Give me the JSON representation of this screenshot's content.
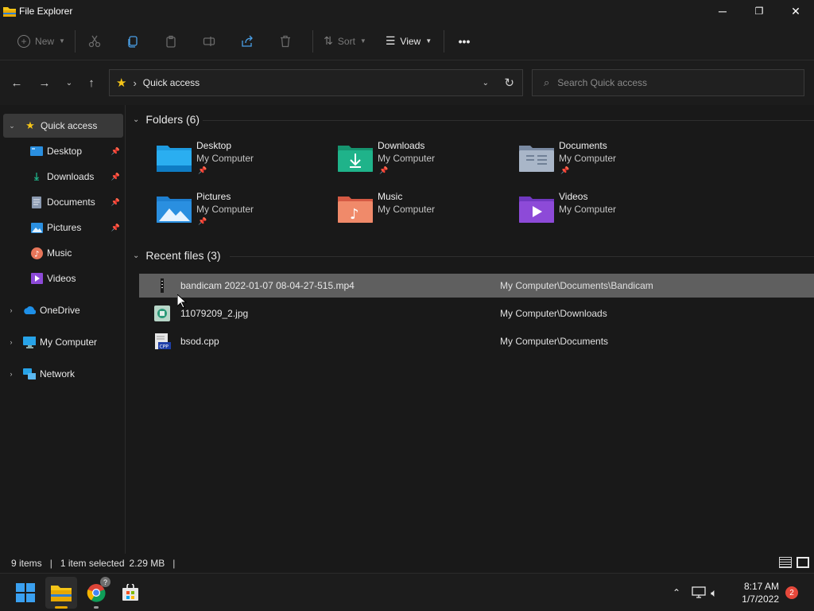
{
  "window": {
    "title": "File Explorer",
    "controls": {
      "minimize": "─",
      "restore": "❐",
      "close": "✕"
    }
  },
  "toolbar": {
    "new_label": "New",
    "sort_label": "Sort",
    "view_label": "View",
    "more_label": "•••"
  },
  "address": {
    "crumb": "Quick access",
    "separator": "›",
    "search_placeholder": "Search Quick access"
  },
  "sidebar": {
    "items": [
      {
        "label": "Quick access",
        "icon": "star-icon",
        "pinned": false
      },
      {
        "label": "Desktop",
        "icon": "desktop-icon",
        "pinned": true
      },
      {
        "label": "Downloads",
        "icon": "download-icon",
        "pinned": true
      },
      {
        "label": "Documents",
        "icon": "document-icon",
        "pinned": true
      },
      {
        "label": "Pictures",
        "icon": "pictures-icon",
        "pinned": true
      },
      {
        "label": "Music",
        "icon": "music-icon",
        "pinned": false
      },
      {
        "label": "Videos",
        "icon": "videos-icon",
        "pinned": false
      },
      {
        "label": "OneDrive",
        "icon": "cloud-icon",
        "pinned": false
      },
      {
        "label": "My Computer",
        "icon": "computer-icon",
        "pinned": false
      },
      {
        "label": "Network",
        "icon": "network-icon",
        "pinned": false
      }
    ]
  },
  "folders": {
    "header": "Folders (6)",
    "items": [
      {
        "name": "Desktop",
        "location": "My Computer",
        "pinned": true,
        "color": "#1e9be0"
      },
      {
        "name": "Downloads",
        "location": "My Computer",
        "pinned": true,
        "color": "#1fb38a"
      },
      {
        "name": "Documents",
        "location": "My Computer",
        "pinned": true,
        "color": "#8a99b0"
      },
      {
        "name": "Pictures",
        "location": "My Computer",
        "pinned": true,
        "color": "#2a8fe0"
      },
      {
        "name": "Music",
        "location": "My Computer",
        "pinned": false,
        "color": "#e8765a"
      },
      {
        "name": "Videos",
        "location": "My Computer",
        "pinned": false,
        "color": "#8d4ad8"
      }
    ]
  },
  "recent": {
    "header": "Recent files (3)",
    "items": [
      {
        "name": "bandicam 2022-01-07 08-04-27-515.mp4",
        "path": "My Computer\\Documents\\Bandicam",
        "selected": true
      },
      {
        "name": "11079209_2.jpg",
        "path": "My Computer\\Downloads",
        "selected": false
      },
      {
        "name": "bsod.cpp",
        "path": "My Computer\\Documents",
        "selected": false
      }
    ]
  },
  "status": {
    "count": "9 items",
    "selection": "1 item selected",
    "size": "2.29 MB",
    "separator": "|"
  },
  "taskbar": {
    "time": "8:17 AM",
    "date": "1/7/2022",
    "notifications": "2",
    "chrome_badge": "?"
  },
  "colors": {
    "accent": "#0078d4",
    "selection": "#5f5f5f",
    "star": "#f5c518"
  }
}
